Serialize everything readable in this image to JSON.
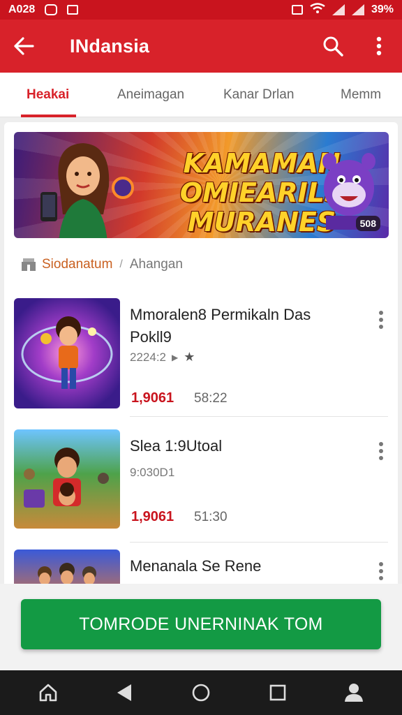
{
  "status_bar": {
    "time": "A028",
    "battery": "39%"
  },
  "app_bar": {
    "title": "INdansia",
    "back_icon": "arrow-left-icon",
    "search_icon": "search-icon",
    "menu_icon": "more-vert-icon"
  },
  "tabs": [
    {
      "label": "Heakai",
      "active": true
    },
    {
      "label": "Aneimagan",
      "active": false
    },
    {
      "label": "Kanar Drlan",
      "active": false
    },
    {
      "label": "Memm",
      "active": false
    }
  ],
  "banner": {
    "line1": "KAMAMAN",
    "line2": "OMIEARILS",
    "line3": "MURANES",
    "badge": "508"
  },
  "breadcrumb": {
    "home": "Siodanatum",
    "separator": "/",
    "current": "Ahangan"
  },
  "items": [
    {
      "title": "Mmoralen8 Permikaln Das Pokll9",
      "meta": "2224:2",
      "price": "1,9061",
      "duration": "58:22"
    },
    {
      "title": "Slea 1:9Utoal",
      "meta": "9:030D1",
      "price": "1,9061",
      "duration": "51:30"
    },
    {
      "title": "Menanala Se Rene",
      "meta": "",
      "price": "",
      "duration": ""
    }
  ],
  "cta": {
    "label": "TOMRODE UNERNINAK TOM"
  },
  "nav_bar": {
    "icons": [
      "home-icon",
      "back-triangle-icon",
      "circle-home-icon",
      "square-recents-icon",
      "person-icon"
    ]
  },
  "colors": {
    "primary": "#d8222a",
    "status_bar": "#c9141e",
    "cta": "#139a44",
    "price": "#c9141e"
  }
}
